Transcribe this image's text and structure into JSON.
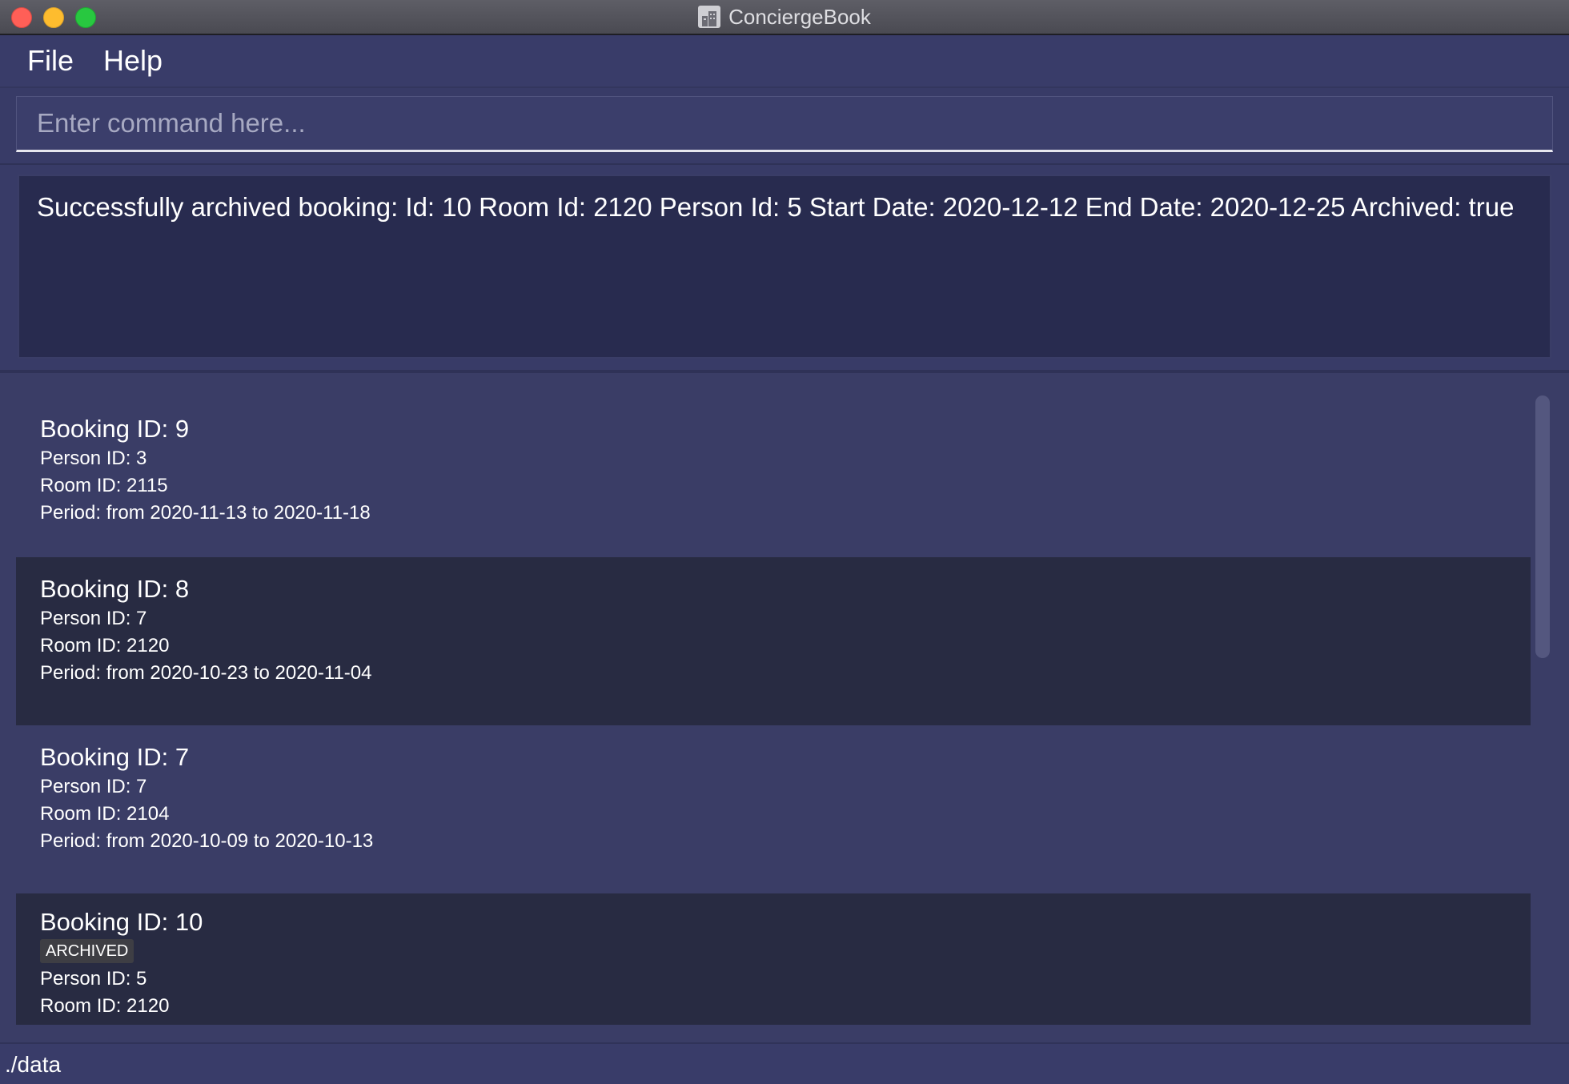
{
  "window": {
    "title": "ConciergeBook",
    "app_icon": "building-icon"
  },
  "menu": {
    "file_label": "File",
    "help_label": "Help"
  },
  "command": {
    "placeholder": "Enter command here...",
    "value": ""
  },
  "result": {
    "message": "Successfully archived booking: Id: 10 Room Id: 2120 Person Id: 5 Start Date: 2020-12-12 End Date: 2020-12-25 Archived: true"
  },
  "bookings": [
    {
      "title": "Booking ID: 9",
      "person": "Person ID: 3",
      "room": "Room ID: 2115",
      "period": "Period: from 2020-11-13 to 2020-11-18"
    },
    {
      "title": "Booking ID: 8",
      "person": "Person ID: 7",
      "room": "Room ID: 2120",
      "period": "Period: from 2020-10-23 to 2020-11-04"
    },
    {
      "title": "Booking ID: 7",
      "person": "Person ID: 7",
      "room": "Room ID: 2104",
      "period": "Period: from 2020-10-09 to 2020-10-13"
    },
    {
      "title": "Booking ID: 10",
      "badge": "ARCHIVED",
      "person": "Person ID: 5",
      "room": "Room ID: 2120"
    }
  ],
  "status": {
    "path": "./data"
  },
  "colors": {
    "background": "#3a3d66",
    "dark_card": "#282b42",
    "result_box": "#282b4f",
    "text": "#ffffff"
  }
}
